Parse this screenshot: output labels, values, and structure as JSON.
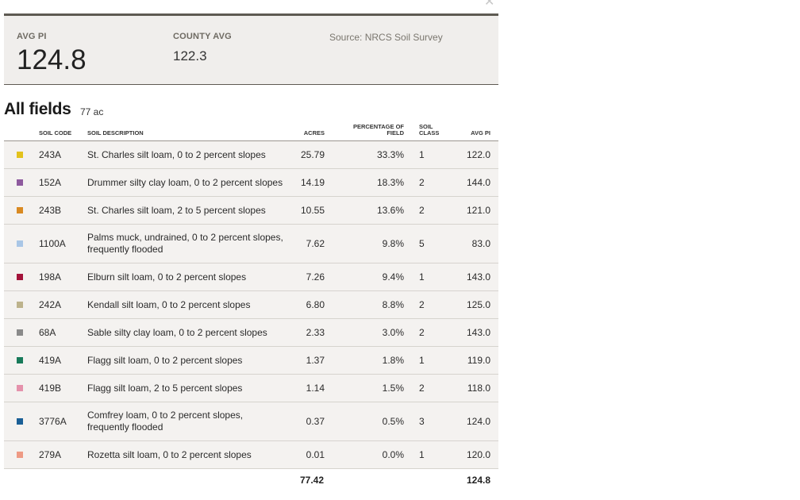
{
  "summary": {
    "avg_pi_label": "AVG PI",
    "avg_pi_value": "124.8",
    "county_avg_label": "COUNTY AVG",
    "county_avg_value": "122.3",
    "source": "Source: NRCS Soil Survey"
  },
  "heading": {
    "title": "All fields",
    "acres": "77 ac"
  },
  "columns": {
    "code": "SOIL CODE",
    "description": "SOIL DESCRIPTION",
    "acres": "ACRES",
    "percentage": "PERCENTAGE OF FIELD",
    "class": "SOIL CLASS",
    "avg_pi": "AVG PI"
  },
  "rows": [
    {
      "color": "#e3c21c",
      "code": "243A",
      "description": "St. Charles silt loam, 0 to 2 percent slopes",
      "acres": "25.79",
      "percentage": "33.3%",
      "class": "1",
      "avg_pi": "122.0"
    },
    {
      "color": "#8e5a9e",
      "code": "152A",
      "description": "Drummer silty clay loam, 0 to 2 percent slopes",
      "acres": "14.19",
      "percentage": "18.3%",
      "class": "2",
      "avg_pi": "144.0"
    },
    {
      "color": "#d98a22",
      "code": "243B",
      "description": "St. Charles silt loam, 2 to 5 percent slopes",
      "acres": "10.55",
      "percentage": "13.6%",
      "class": "2",
      "avg_pi": "121.0"
    },
    {
      "color": "#a9c6e6",
      "code": "1100A",
      "description": "Palms muck, undrained, 0 to 2 percent slopes, frequently flooded",
      "acres": "7.62",
      "percentage": "9.8%",
      "class": "5",
      "avg_pi": "83.0"
    },
    {
      "color": "#a3133a",
      "code": "198A",
      "description": "Elburn silt loam, 0 to 2 percent slopes",
      "acres": "7.26",
      "percentage": "9.4%",
      "class": "1",
      "avg_pi": "143.0"
    },
    {
      "color": "#bdb38c",
      "code": "242A",
      "description": "Kendall silt loam, 0 to 2 percent slopes",
      "acres": "6.80",
      "percentage": "8.8%",
      "class": "2",
      "avg_pi": "125.0"
    },
    {
      "color": "#8a8a8a",
      "code": "68A",
      "description": "Sable silty clay loam, 0 to 2 percent slopes",
      "acres": "2.33",
      "percentage": "3.0%",
      "class": "2",
      "avg_pi": "143.0"
    },
    {
      "color": "#187a5a",
      "code": "419A",
      "description": "Flagg silt loam, 0 to 2 percent slopes",
      "acres": "1.37",
      "percentage": "1.8%",
      "class": "1",
      "avg_pi": "119.0"
    },
    {
      "color": "#e592ac",
      "code": "419B",
      "description": "Flagg silt loam, 2 to 5 percent slopes",
      "acres": "1.14",
      "percentage": "1.5%",
      "class": "2",
      "avg_pi": "118.0"
    },
    {
      "color": "#1a5f96",
      "code": "3776A",
      "description": "Comfrey loam, 0 to 2 percent slopes, frequently flooded",
      "acres": "0.37",
      "percentage": "0.5%",
      "class": "3",
      "avg_pi": "124.0"
    },
    {
      "color": "#ee9a84",
      "code": "279A",
      "description": "Rozetta silt loam, 0 to 2 percent slopes",
      "acres": "0.01",
      "percentage": "0.0%",
      "class": "1",
      "avg_pi": "120.0"
    }
  ],
  "totals": {
    "acres": "77.42",
    "avg_pi": "124.8"
  }
}
